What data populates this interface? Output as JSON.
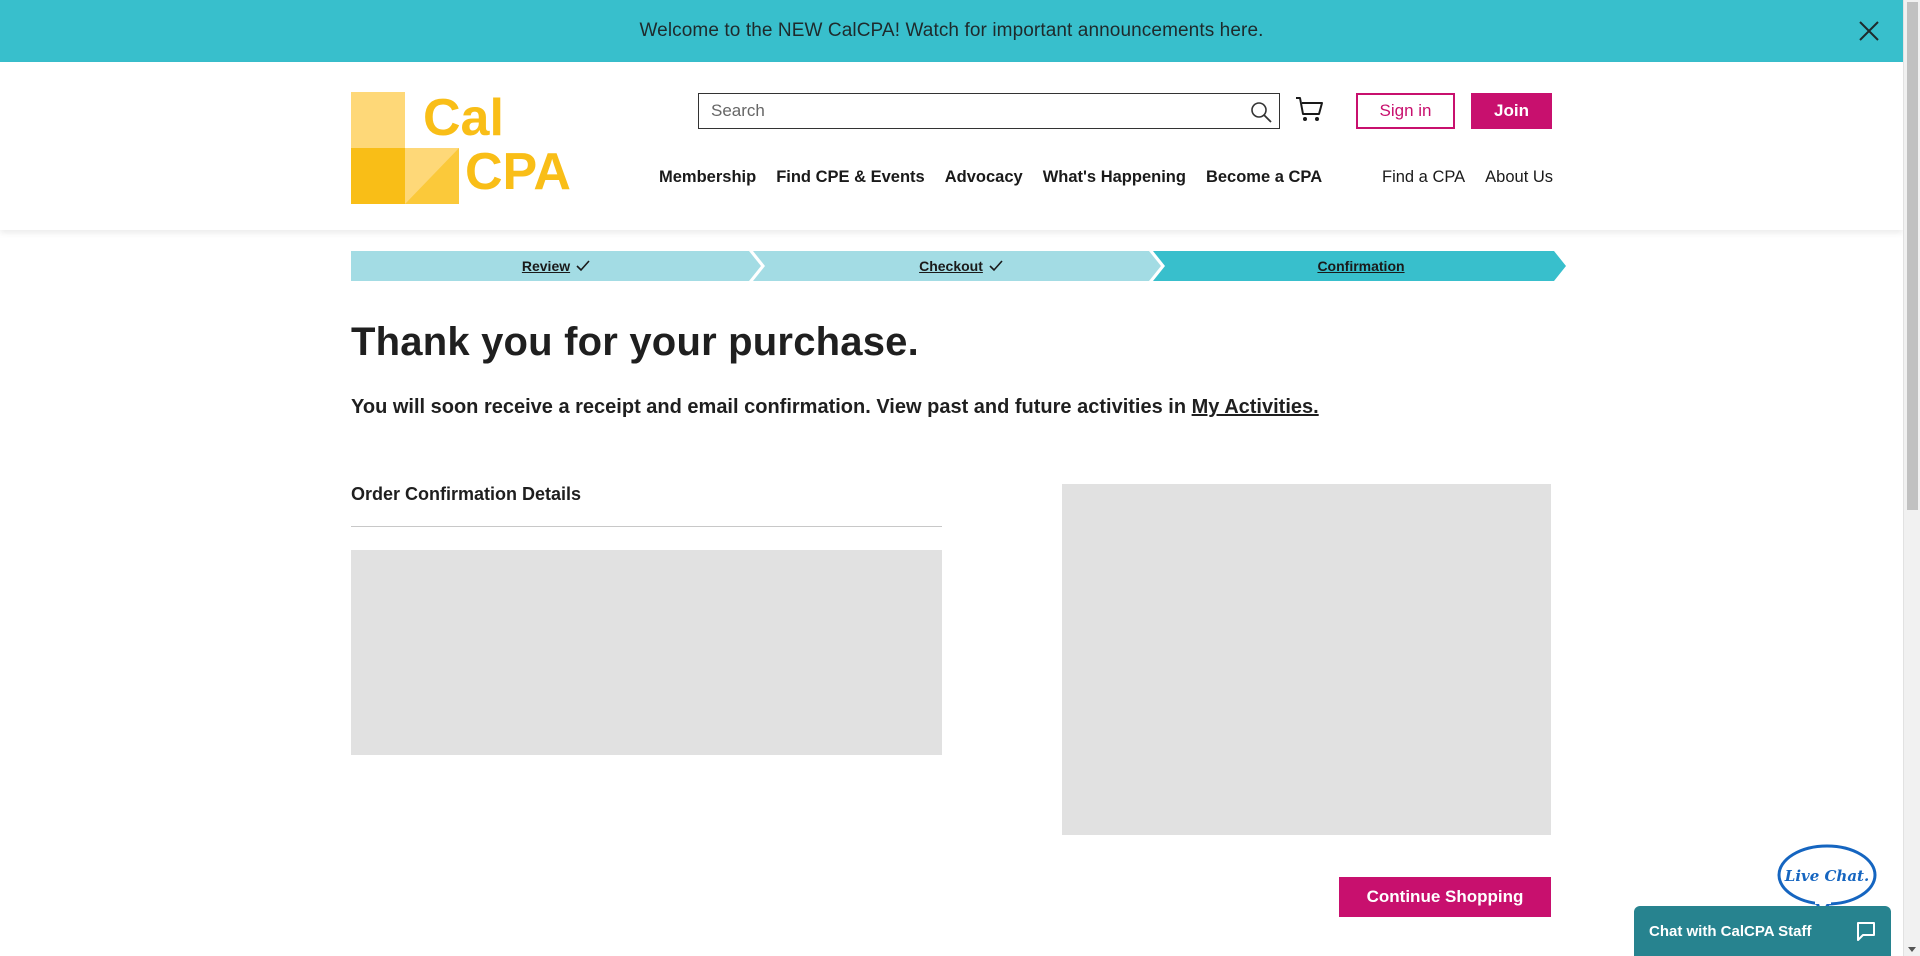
{
  "announcement": {
    "text": "Welcome to the NEW CalCPA! Watch for important announcements here."
  },
  "logo": {
    "line1": "Cal",
    "line2": "CPA"
  },
  "search": {
    "placeholder": "Search"
  },
  "header": {
    "signin_label": "Sign in",
    "join_label": "Join",
    "nav_main": [
      "Membership",
      "Find CPE & Events",
      "Advocacy",
      "What's Happening",
      "Become a CPA"
    ],
    "nav_secondary": [
      "Find a CPA",
      "About Us"
    ]
  },
  "steps": [
    {
      "label": "Review",
      "completed": true
    },
    {
      "label": "Checkout",
      "completed": true
    },
    {
      "label": "Confirmation",
      "completed": false,
      "current": true
    }
  ],
  "main": {
    "title": "Thank you for your purchase.",
    "receipt_prefix": "You will soon receive a receipt and email confirmation. View past and future activities in ",
    "activities_link": "My Activities.",
    "order_details_title": "Order Confirmation Details",
    "continue_label": "Continue Shopping"
  },
  "chat": {
    "bubble_text": "Live Chat.",
    "bar_label": "Chat with CalCPA Staff"
  },
  "colors": {
    "announcement_bg": "#38bfcc",
    "brand_magenta": "#c8106e",
    "logo_yellow": "#f9be17",
    "step_light": "#a3dce4",
    "step_active": "#38bfcc",
    "chat_teal": "#27838f",
    "placeholder_gray": "#e1e1e1"
  }
}
